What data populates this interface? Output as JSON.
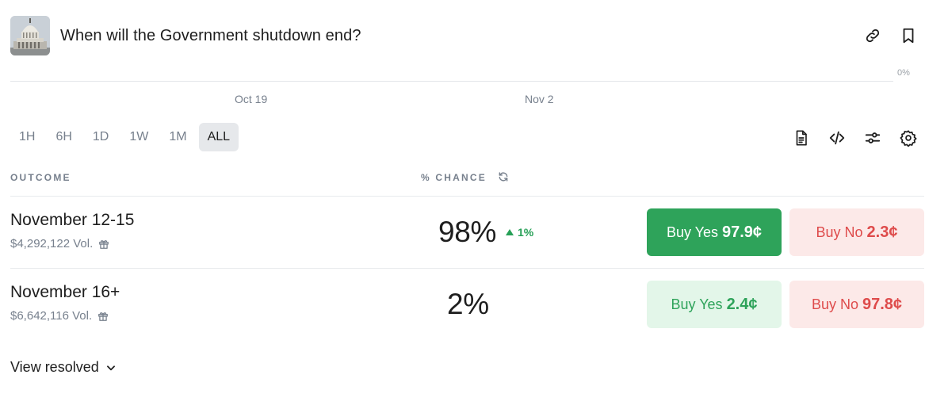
{
  "header": {
    "title": "When will the Government shutdown end?",
    "thumbnail_icon": "capitol-building-image",
    "link_icon": "link-icon",
    "bookmark_icon": "bookmark-icon"
  },
  "chart": {
    "y_label": "0%",
    "x_ticks": [
      "Oct 19",
      "Nov 2"
    ]
  },
  "time_ranges": {
    "options": [
      "1H",
      "6H",
      "1D",
      "1W",
      "1M",
      "ALL"
    ],
    "selected": "ALL"
  },
  "tools": [
    "document-icon",
    "code-icon",
    "sliders-icon",
    "gear-icon"
  ],
  "table": {
    "headers": {
      "outcome": "OUTCOME",
      "chance": "% CHANCE"
    },
    "rows": [
      {
        "name": "November 12-15",
        "volume": "$4,292,122 Vol.",
        "chance": "98%",
        "delta": "1%",
        "delta_direction": "up",
        "yes_label": "Buy Yes",
        "yes_price": "97.9¢",
        "no_label": "Buy No",
        "no_price": "2.3¢"
      },
      {
        "name": "November 16+",
        "volume": "$6,642,116 Vol.",
        "chance": "2%",
        "yes_label": "Buy Yes",
        "yes_price": "2.4¢",
        "no_label": "Buy No",
        "no_price": "97.8¢"
      }
    ]
  },
  "footer": {
    "view_resolved": "View resolved"
  },
  "colors": {
    "green": "#2ea35a",
    "green_soft": "#e3f6e9",
    "red": "#de4b4b",
    "red_soft": "#fce9e8",
    "muted": "#77808d"
  }
}
